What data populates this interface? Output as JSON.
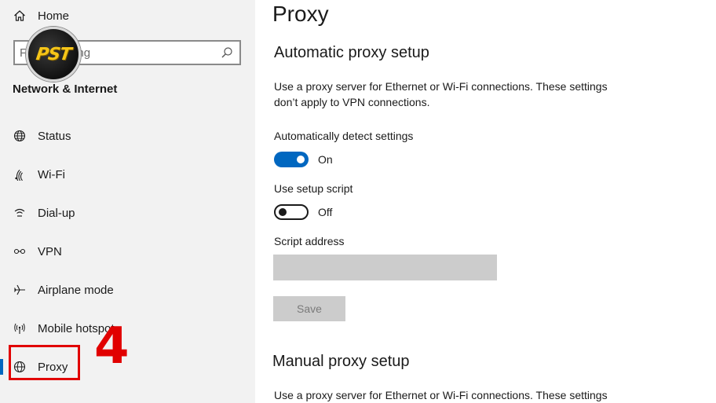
{
  "sidebar": {
    "home_label": "Home",
    "search": {
      "value": "",
      "placeholder": "Find a setting"
    },
    "section_title": "Network & Internet",
    "items": [
      {
        "label": "Status",
        "icon": "globe-network-icon"
      },
      {
        "label": "Wi-Fi",
        "icon": "wifi-icon"
      },
      {
        "label": "Dial-up",
        "icon": "dialup-icon"
      },
      {
        "label": "VPN",
        "icon": "vpn-icon"
      },
      {
        "label": "Airplane mode",
        "icon": "airplane-icon"
      },
      {
        "label": "Mobile hotspot",
        "icon": "hotspot-icon"
      },
      {
        "label": "Proxy",
        "icon": "globe-icon",
        "selected": true
      }
    ]
  },
  "overlay": {
    "logo_text": "PST",
    "step_number": "4",
    "highlight_color": "#e10000"
  },
  "main": {
    "page_title": "Proxy",
    "automatic": {
      "heading": "Automatic proxy setup",
      "description": "Use a proxy server for Ethernet or Wi-Fi connections. These settings don’t apply to VPN connections.",
      "auto_detect": {
        "label": "Automatically detect settings",
        "state": "On",
        "on": true
      },
      "setup_script": {
        "label": "Use setup script",
        "state": "Off",
        "on": false
      },
      "script_address": {
        "label": "Script address",
        "value": ""
      },
      "save_label": "Save"
    },
    "manual": {
      "heading": "Manual proxy setup",
      "description": "Use a proxy server for Ethernet or Wi-Fi connections. These settings"
    }
  },
  "colors": {
    "accent": "#0067c0",
    "sidebar_bg": "#f2f2f2",
    "disabled": "#cccccc"
  }
}
